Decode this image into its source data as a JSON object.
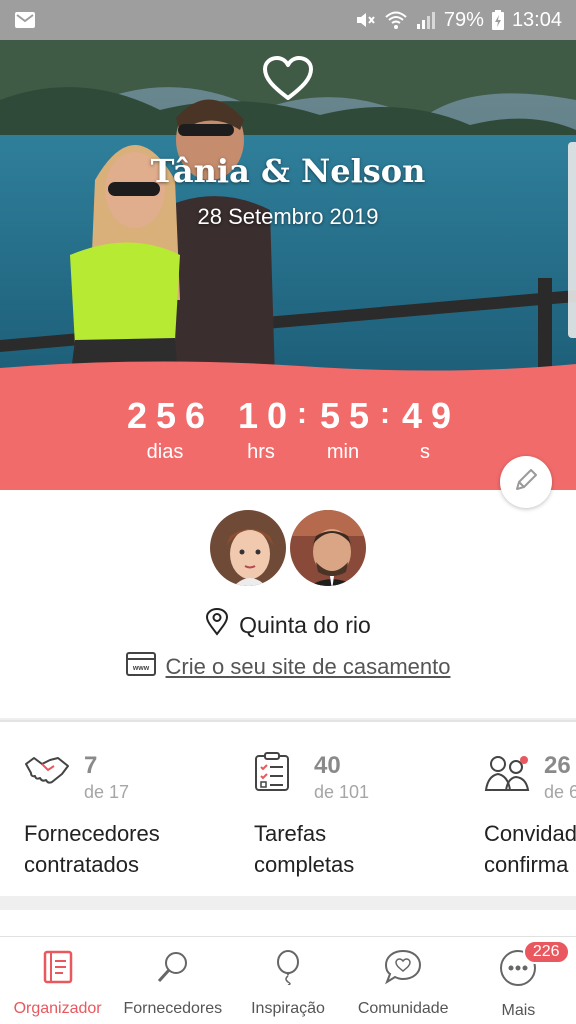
{
  "statusbar": {
    "battery": "79%",
    "time": "13:04"
  },
  "hero": {
    "names": "Tânia & Nelson",
    "date": "28 Setembro 2019"
  },
  "countdown": {
    "days": "256",
    "hours": "10",
    "minutes": "55",
    "seconds": "49",
    "days_label": "dias",
    "hours_label": "hrs",
    "minutes_label": "min",
    "seconds_label": "s"
  },
  "info": {
    "location": "Quinta do rio",
    "site_link": "Crie o seu site de casamento"
  },
  "stats": [
    {
      "value": "7",
      "of": "de 17",
      "label_line1": "Fornecedores",
      "label_line2": "contratados",
      "icon": "handshake-icon"
    },
    {
      "value": "40",
      "of": "de 101",
      "label_line1": "Tarefas",
      "label_line2": "completas",
      "icon": "checklist-icon"
    },
    {
      "value": "26",
      "of": "de 6",
      "label_line1": "Convidad",
      "label_line2": "confirma",
      "icon": "guests-icon"
    }
  ],
  "nav": [
    {
      "label": "Organizador",
      "icon": "notebook-icon",
      "active": true
    },
    {
      "label": "Fornecedores",
      "icon": "magnifier-icon"
    },
    {
      "label": "Inspiração",
      "icon": "balloon-icon"
    },
    {
      "label": "Comunidade",
      "icon": "chat-heart-icon"
    },
    {
      "label": "Mais",
      "icon": "more-dots-icon",
      "badge": "226"
    }
  ],
  "colors": {
    "accent": "#f26b6b",
    "nav_active": "#e8585e"
  }
}
